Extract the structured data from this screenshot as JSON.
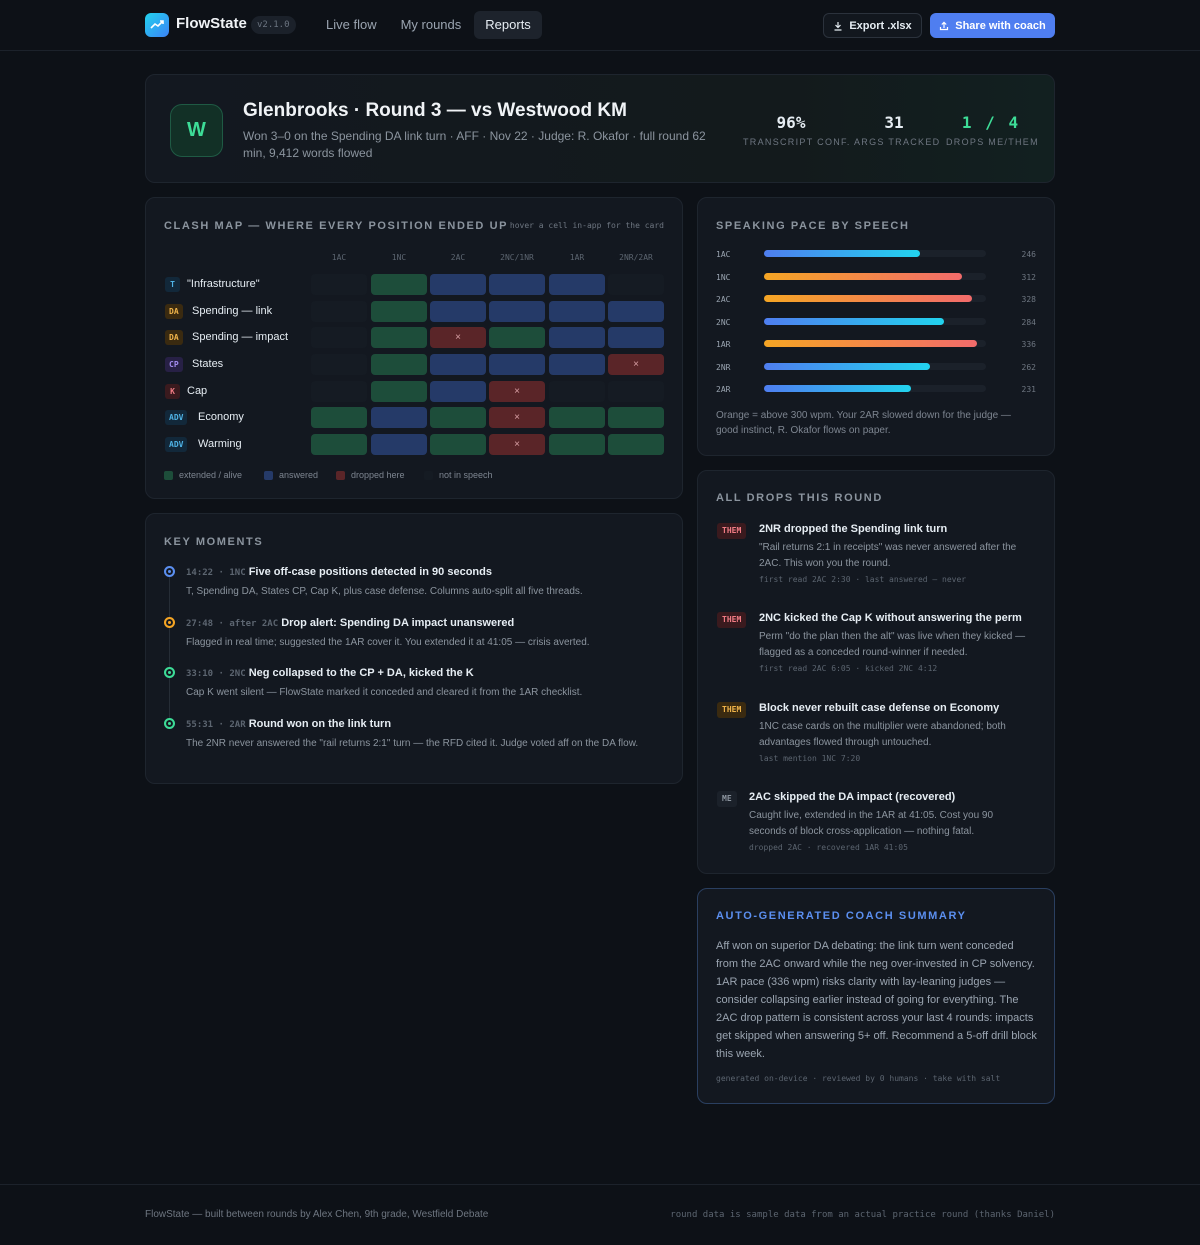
{
  "app": {
    "name": "FlowState",
    "version": "v2.1.0",
    "nav": [
      "Live flow",
      "My rounds",
      "Reports"
    ],
    "active_nav": "Reports",
    "export_label": "Export .xlsx",
    "share_label": "Share with coach",
    "accent": "#4f7ef0"
  },
  "hero": {
    "avatar": "W",
    "title": "Glenbrooks · Round 3 — vs Westwood KM",
    "subtitle": "Won 3–0 on the Spending DA link turn · AFF · Nov 22 · Judge: R. Okafor · full round 62 min, 9,412 words flowed",
    "stats": [
      {
        "value": "96%",
        "label": "Transcript conf."
      },
      {
        "value": "31",
        "label": "Args tracked"
      },
      {
        "value": "1 / 4",
        "label": "Drops me/them"
      }
    ]
  },
  "clash": {
    "title": "Clash map — where every position ended up",
    "hint": "hover a cell in-app for the card",
    "columns": [
      "1AC",
      "1NC",
      "2AC",
      "2NC/1NR",
      "1AR",
      "2NR/2AR"
    ],
    "rows": [
      {
        "tag": "T",
        "name": "\"Infrastructure\"",
        "cells": [
          "none",
          "ext",
          "ans",
          "ans",
          "ans",
          "none"
        ]
      },
      {
        "tag": "DA",
        "name": "Spending — link",
        "cells": [
          "none",
          "ext",
          "ans",
          "ans",
          "ans",
          "ans"
        ]
      },
      {
        "tag": "DA",
        "name": "Spending — impact",
        "cells": [
          "none",
          "ext",
          "drop",
          "ext",
          "ans",
          "ans"
        ]
      },
      {
        "tag": "CP",
        "name": "States",
        "cells": [
          "none",
          "ext",
          "ans",
          "ans",
          "ans",
          "drop"
        ]
      },
      {
        "tag": "K",
        "name": "Cap",
        "cells": [
          "none",
          "ext",
          "ans",
          "drop",
          "none",
          "none"
        ]
      },
      {
        "tag": "ADV",
        "name": "Economy",
        "cells": [
          "ext",
          "ans",
          "ext",
          "drop",
          "ext",
          "ext"
        ]
      },
      {
        "tag": "ADV",
        "name": "Warming",
        "cells": [
          "ext",
          "ans",
          "ext",
          "drop",
          "ext",
          "ext"
        ]
      }
    ],
    "drop_mark": "×",
    "legend": [
      {
        "key": "ext",
        "label": "extended / alive"
      },
      {
        "key": "ans",
        "label": "answered"
      },
      {
        "key": "drop",
        "label": "dropped here"
      },
      {
        "key": "none",
        "label": "not in speech"
      }
    ]
  },
  "pace": {
    "title": "Speaking pace by speech",
    "speeches": [
      {
        "label": "1AC",
        "wpm": 246,
        "value": "246"
      },
      {
        "label": "1NC",
        "wpm": 312,
        "value": "312"
      },
      {
        "label": "2AC",
        "wpm": 328,
        "value": "328"
      },
      {
        "label": "2NC",
        "wpm": 284,
        "value": "284"
      },
      {
        "label": "1AR",
        "wpm": 336,
        "value": "336"
      },
      {
        "label": "2NR",
        "wpm": 262,
        "value": "262"
      },
      {
        "label": "2AR",
        "wpm": 231,
        "value": "231"
      }
    ],
    "threshold_wpm": 300,
    "note": "Orange = above 300 wpm. Your 2AR slowed down for the judge — good instinct, R. Okafor flows on paper."
  },
  "moments": {
    "title": "Key moments",
    "items": [
      {
        "time": "14:22",
        "speech": "1NC",
        "headline": "Five off-case positions detected in 90 seconds",
        "body": "T, Spending DA, States CP, Cap K, plus case defense. Columns auto-split all five threads.",
        "color": "#5b8ff0"
      },
      {
        "time": "27:48",
        "speech": "after 2AC",
        "headline": "Drop alert: Spending DA impact unanswered",
        "body": "Flagged in real time; suggested the 1AR cover it. You extended it at 41:05 — crisis averted.",
        "color": "#f5a524"
      },
      {
        "time": "33:10",
        "speech": "2NC",
        "headline": "Neg collapsed to the CP + DA, kicked the K",
        "body": "Cap K went silent — FlowState marked it conceded and cleared it from the 1AR checklist.",
        "color": "#3ddc97"
      },
      {
        "time": "55:31",
        "speech": "2AR",
        "headline": "Round won on the link turn",
        "body": "The 2NR never answered the \"rail returns 2:1\" turn — the RFD cited it. Judge voted aff on the DA flow.",
        "color": "#3ddc97"
      }
    ]
  },
  "drops": {
    "title": "All drops this round",
    "items": [
      {
        "tag": "THEM",
        "title": "2NR dropped the Spending link turn",
        "body": "\"Rail returns 2:1 in receipts\" was never answered after the 2AC. This won you the round.",
        "meta": "first read 2AC 2:30  ·  last answered — never"
      },
      {
        "tag": "THEM",
        "title": "2NC kicked the Cap K without answering the perm",
        "body": "Perm \"do the plan then the alt\" was live when they kicked — flagged as a conceded round-winner if needed.",
        "meta": "first read 2AC 6:05  ·  kicked 2NC 4:12"
      },
      {
        "tag": "THEM",
        "title": "Block never rebuilt case defense on Economy",
        "body": "1NC case cards on the multiplier were abandoned; both advantages flowed through untouched.",
        "meta": "last mention 1NC 7:20"
      },
      {
        "tag": "ME",
        "title": "2AC skipped the DA impact (recovered)",
        "body": "Caught live, extended in the 1AR at 41:05. Cost you 90 seconds of block cross-application — nothing fatal.",
        "meta": "dropped 2AC  ·  recovered 1AR 41:05"
      }
    ]
  },
  "summary": {
    "title": "Auto-generated coach summary",
    "body": "Aff won on superior DA debating: the link turn went conceded from the 2AC onward while the neg over-invested in CP solvency. 1AR pace (336 wpm) risks clarity with lay-leaning judges — consider collapsing earlier instead of going for everything. The 2AC drop pattern is consistent across your last 4 rounds: impacts get skipped when answering 5+ off. Recommend a 5-off drill block this week.",
    "footer": "generated on-device  ·  reviewed by 0 humans  ·  take with salt"
  },
  "footer": {
    "left": "FlowState — built between rounds by Alex Chen, 9th grade, Westfield Debate",
    "right": "round data is sample data from an actual practice round (thanks Daniel)"
  }
}
